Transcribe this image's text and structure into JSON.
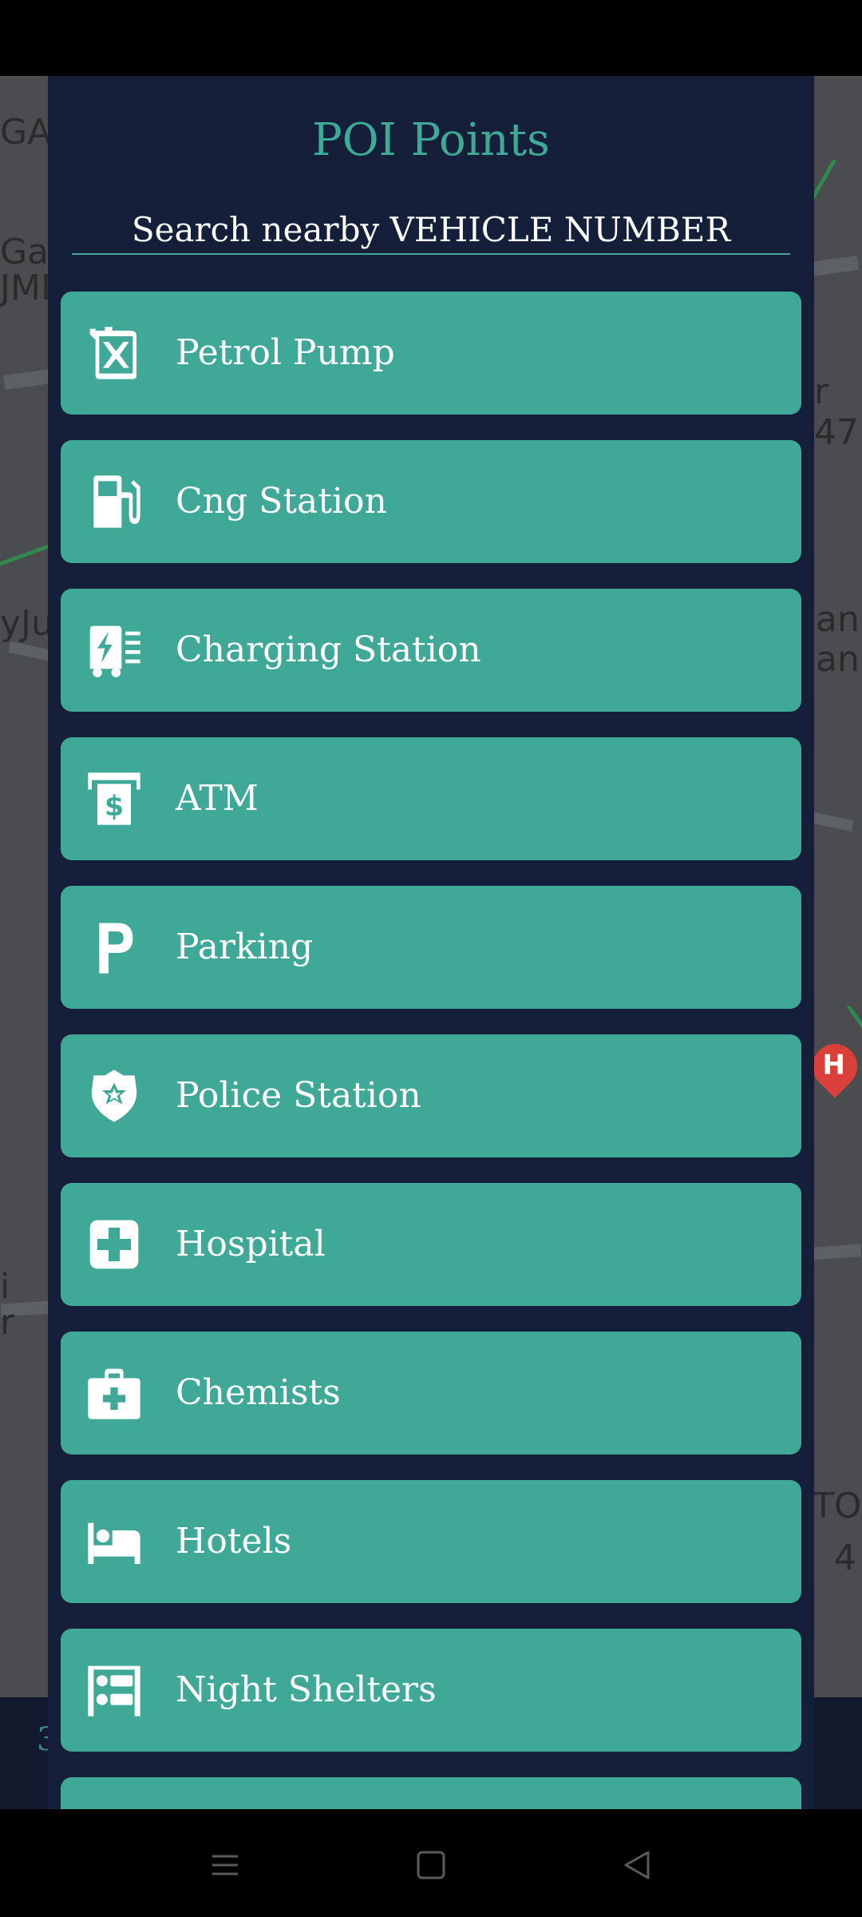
{
  "dialog": {
    "title": "POI Points",
    "subtitle": "Search nearby VEHICLE NUMBER"
  },
  "poi_items": [
    {
      "label": "Petrol Pump",
      "icon": "fuel-can-icon"
    },
    {
      "label": "Cng Station",
      "icon": "gas-pump-icon"
    },
    {
      "label": "Charging Station",
      "icon": "charging-station-icon"
    },
    {
      "label": "ATM",
      "icon": "atm-icon"
    },
    {
      "label": "Parking",
      "icon": "parking-icon"
    },
    {
      "label": "Police Station",
      "icon": "police-badge-icon"
    },
    {
      "label": "Hospital",
      "icon": "hospital-cross-icon"
    },
    {
      "label": "Chemists",
      "icon": "medical-bag-icon"
    },
    {
      "label": "Hotels",
      "icon": "bed-icon"
    },
    {
      "label": "Night Shelters",
      "icon": "shelter-bed-icon"
    }
  ],
  "map": {
    "labels": [
      "GAR",
      "Garc",
      "JMD",
      "r 47",
      "yJur",
      "ank",
      "anu",
      "i",
      "r",
      "TO",
      "4"
    ],
    "pin_letter": "H",
    "bottom_text": "3"
  },
  "nav": {
    "menu_icon": "menu-icon",
    "home_icon": "home-square-icon",
    "back_icon": "back-triangle-icon"
  },
  "colors": {
    "dialog_bg": "#151f3a",
    "accent": "#3ea996",
    "item_bg": "#3fa896",
    "text": "#ffffff"
  }
}
